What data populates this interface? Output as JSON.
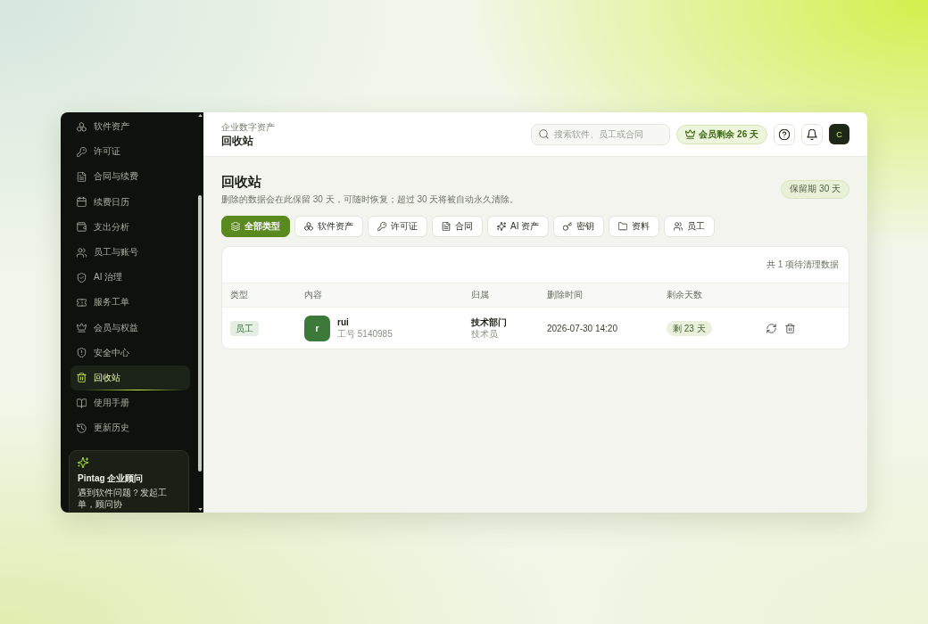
{
  "sidebar": {
    "items": [
      {
        "label": "软件资产",
        "selected": false
      },
      {
        "label": "许可证",
        "selected": false
      },
      {
        "label": "合同与续费",
        "selected": false
      },
      {
        "label": "续费日历",
        "selected": false
      },
      {
        "label": "支出分析",
        "selected": false
      },
      {
        "label": "员工与账号",
        "selected": false
      },
      {
        "label": "AI 治理",
        "selected": false
      },
      {
        "label": "服务工单",
        "selected": false
      },
      {
        "label": "会员与权益",
        "selected": false
      },
      {
        "label": "安全中心",
        "selected": false
      },
      {
        "label": "回收站",
        "selected": true
      },
      {
        "label": "使用手册",
        "selected": false
      },
      {
        "label": "更新历史",
        "selected": false
      }
    ],
    "promo": {
      "title": "Pintag 企业顾问",
      "text": "遇到软件问题？发起工单，顾问协"
    }
  },
  "header": {
    "breadcrumb": "企业数字资产",
    "title": "回收站",
    "search": {
      "placeholder": "搜索软件、员工或合同"
    },
    "membership": "会员剩余 26 天",
    "avatar_initial": "C"
  },
  "page": {
    "title": "回收站",
    "subtitle": "删除的数据会在此保留 30 天，可随时恢复；超过 30 天将被自动永久清除。",
    "retention": "保留期 30 天"
  },
  "filters": [
    {
      "label": "全部类型",
      "selected": true
    },
    {
      "label": "软件资产",
      "selected": false
    },
    {
      "label": "许可证",
      "selected": false
    },
    {
      "label": "合同",
      "selected": false
    },
    {
      "label": "AI 资产",
      "selected": false
    },
    {
      "label": "密钥",
      "selected": false
    },
    {
      "label": "资料",
      "selected": false
    },
    {
      "label": "员工",
      "selected": false
    }
  ],
  "table": {
    "summary": "共 1 项待清理数据",
    "columns": [
      "类型",
      "内容",
      "归属",
      "删除时间",
      "剩余天数"
    ],
    "rows": [
      {
        "type": "员工",
        "avatar_initial": "r",
        "name": "rui",
        "employee_id": "工号 5140985",
        "department": "技术部门",
        "role": "技术员",
        "deleted_at": "2026-07-30 14:20",
        "remaining": "剩 23 天"
      }
    ]
  }
}
